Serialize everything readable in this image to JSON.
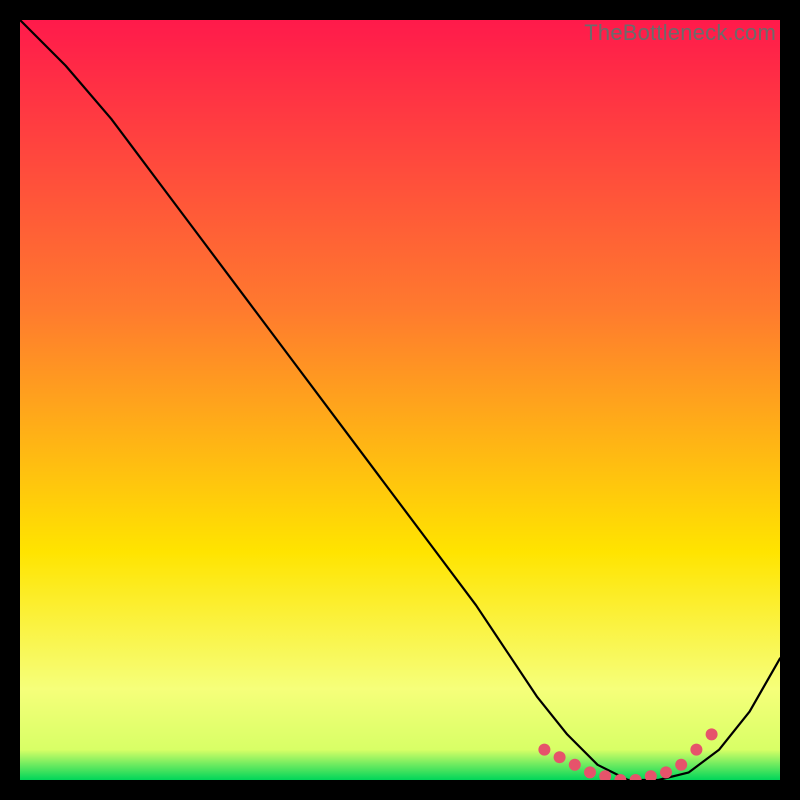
{
  "watermark": "TheBottleneck.com",
  "colors": {
    "grad_top": "#ff1a4b",
    "grad_mid1": "#ff7a2e",
    "grad_mid2": "#ffe400",
    "grad_low": "#f6ff7a",
    "grad_base": "#00d65a",
    "curve": "#000000",
    "dots": "#e6536b",
    "frame": "#000000"
  },
  "chart_data": {
    "type": "line",
    "title": "",
    "xlabel": "",
    "ylabel": "",
    "xlim": [
      0,
      100
    ],
    "ylim": [
      0,
      100
    ],
    "grid": false,
    "legend": false,
    "series": [
      {
        "name": "bottleneck-curve",
        "x": [
          0,
          6,
          12,
          18,
          24,
          30,
          36,
          42,
          48,
          54,
          60,
          64,
          68,
          72,
          76,
          80,
          84,
          88,
          92,
          96,
          100
        ],
        "y": [
          100,
          94,
          87,
          79,
          71,
          63,
          55,
          47,
          39,
          31,
          23,
          17,
          11,
          6,
          2,
          0,
          0,
          1,
          4,
          9,
          16
        ]
      }
    ],
    "optimal_zone": {
      "name": "optimal-dots",
      "x": [
        69,
        71,
        73,
        75,
        77,
        79,
        81,
        83,
        85,
        87,
        89,
        91
      ],
      "y": [
        4,
        3,
        2,
        1,
        0.5,
        0,
        0,
        0.5,
        1,
        2,
        4,
        6
      ]
    },
    "background_gradient_stops": [
      {
        "pct": 0,
        "color": "#ff1a4b"
      },
      {
        "pct": 38,
        "color": "#ff7a2e"
      },
      {
        "pct": 70,
        "color": "#ffe400"
      },
      {
        "pct": 88,
        "color": "#f6ff7a"
      },
      {
        "pct": 96,
        "color": "#d8ff66"
      },
      {
        "pct": 100,
        "color": "#00d65a"
      }
    ]
  }
}
